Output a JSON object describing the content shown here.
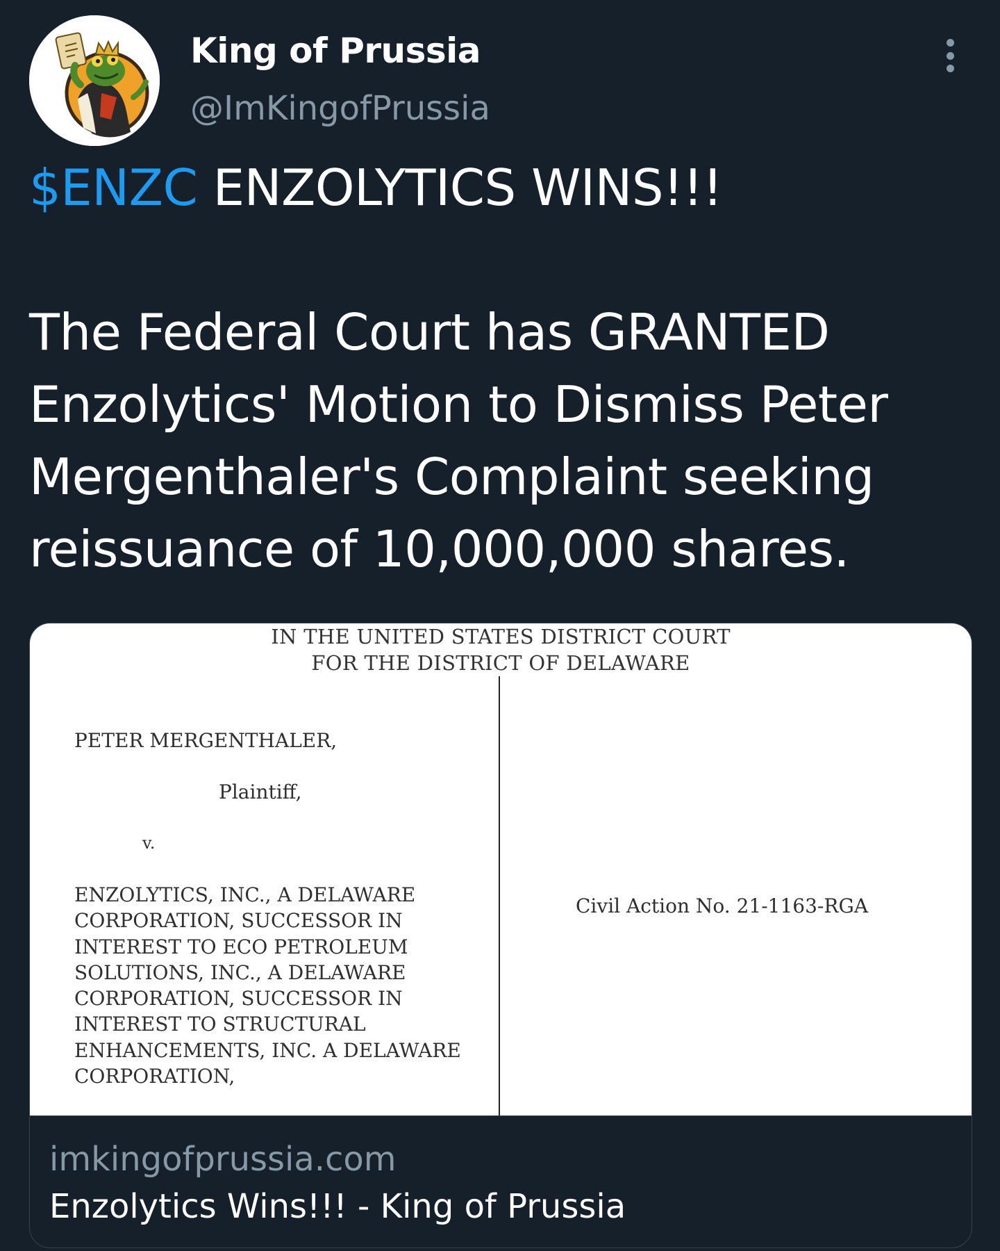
{
  "author": {
    "display_name": "King of Prussia",
    "handle": "@ImKingofPrussia"
  },
  "tweet": {
    "cashtag": "$ENZC",
    "headline": " ENZOLYTICS WINS!!!",
    "body_lines": [
      "The Federal Court has GRANTED",
      "Enzolytics' Motion to Dismiss Peter",
      "Mergenthaler's Complaint seeking",
      "reissuance of 10,000,000 shares."
    ]
  },
  "card": {
    "document": {
      "court_line_1": "IN THE UNITED STATES DISTRICT COURT",
      "court_line_2": "FOR THE DISTRICT OF DELAWARE",
      "plaintiff": "PETER MERGENTHALER,",
      "plaintiff_role": "Plaintiff,",
      "versus": "v.",
      "defendant_lines": [
        "ENZOLYTICS, INC., A DELAWARE",
        "CORPORATION, SUCCESSOR IN",
        "INTEREST TO ECO PETROLEUM",
        "SOLUTIONS, INC., A DELAWARE",
        "CORPORATION, SUCCESSOR IN",
        "INTEREST TO STRUCTURAL",
        "ENHANCEMENTS, INC. A DELAWARE",
        "CORPORATION,"
      ],
      "civil_action": "Civil Action No. 21-1163-RGA"
    },
    "domain": "imkingofprussia.com",
    "title": "Enzolytics Wins!!! - King of Prussia"
  },
  "colors": {
    "background": "#15202b",
    "cashtag": "#1d9bf0",
    "secondary_text": "#8899a6",
    "border": "#38444d"
  },
  "icons": {
    "more": "more-dots-vertical-icon",
    "avatar": "frog-king-avatar"
  }
}
